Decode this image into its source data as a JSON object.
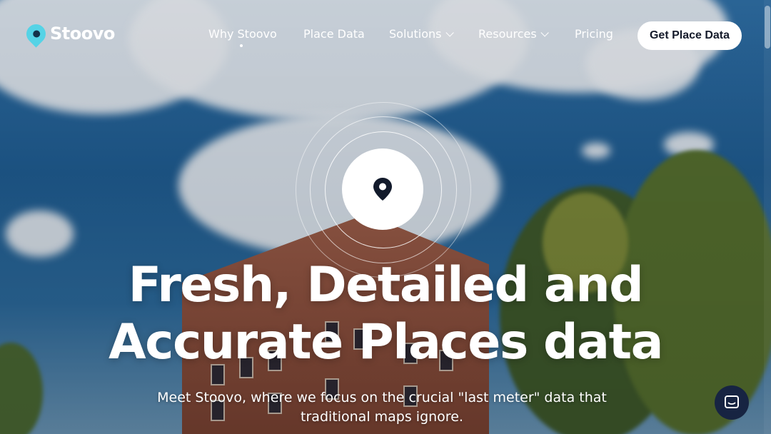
{
  "brand": {
    "name": "Stoovo",
    "logo_icon": "location-pin-smiley-icon",
    "accent": "#55d3e6"
  },
  "nav": {
    "items": [
      {
        "label": "Why Stoovo",
        "has_dropdown": false,
        "active": true
      },
      {
        "label": "Place Data",
        "has_dropdown": false,
        "active": false
      },
      {
        "label": "Solutions",
        "has_dropdown": true,
        "active": false
      },
      {
        "label": "Resources",
        "has_dropdown": true,
        "active": false
      },
      {
        "label": "Pricing",
        "has_dropdown": false,
        "active": false
      }
    ],
    "cta_label": "Get Place Data"
  },
  "hero": {
    "headline_line1": "Fresh, Detailed and",
    "headline_line2": "Accurate Places data",
    "subtext": "Meet Stoovo, where we focus on the crucial \"last meter\" data that traditional maps ignore.",
    "center_icon": "map-pin-icon"
  },
  "chat": {
    "icon": "chat-bubble-icon",
    "color": "#172442"
  }
}
